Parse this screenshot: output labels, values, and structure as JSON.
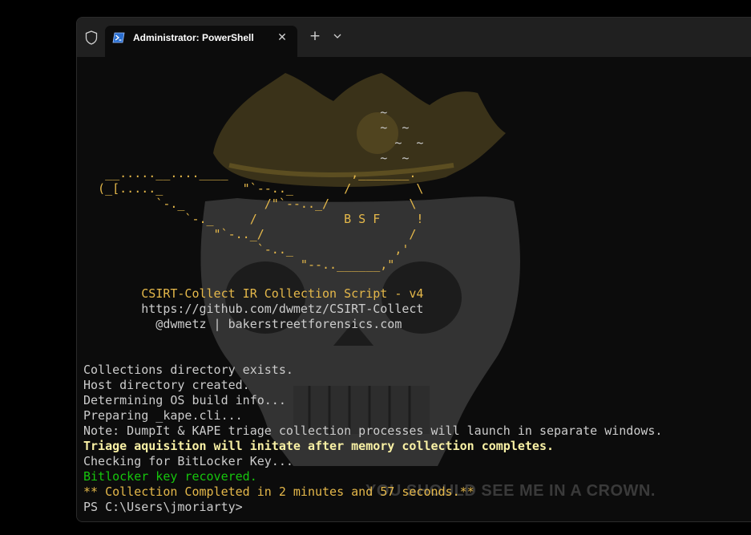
{
  "window": {
    "tab_title": "Administrator: PowerShell",
    "tab_close_glyph": "✕",
    "new_tab_glyph": "+",
    "icons": [
      "shield-icon",
      "powershell-icon",
      "close-icon",
      "plus-icon",
      "chevron-down-icon"
    ]
  },
  "background": {
    "caption": "YOU SHOULD SEE ME IN A CROWN."
  },
  "ascii_art": {
    "lines": [
      "                                         ~",
      "                                         ~  ~",
      "                                           ~  ~",
      "                                         ~  ~",
      "   __.....__....____                 ,_______.",
      "  (_[....._           \"`--.._       /         \\",
      "          `-._           /\"`--.._/           \\",
      "              `-._     /            B S F     !",
      "                  \"`-.._/                    /",
      "                        `-.._              ,'",
      "                              \"--..______,\""
    ]
  },
  "banner": {
    "title": "        CSIRT-Collect IR Collection Script - v4",
    "url": "        https://github.com/dwmetz/CSIRT-Collect",
    "credits": "          @dwmetz | bakerstreetforensics.com"
  },
  "log": [
    {
      "text": "Collections directory exists.",
      "style": "white"
    },
    {
      "text": "Host directory created.",
      "style": "white"
    },
    {
      "text": "Determining OS build info...",
      "style": "white"
    },
    {
      "text": "Preparing _kape.cli...",
      "style": "white"
    },
    {
      "text": "Note: DumpIt & KAPE triage collection processes will launch in separate windows.",
      "style": "white"
    },
    {
      "text": "Triage aquisition will initate after memory collection completes.",
      "style": "yellow"
    },
    {
      "text": "Checking for BitLocker Key...",
      "style": "white"
    },
    {
      "text": "Bitlocker key recovered.",
      "style": "green"
    },
    {
      "text": "** Collection Completed in 2 minutes and 57 seconds.**",
      "style": "orange"
    },
    {
      "text": "PS C:\\Users\\jmoriarty>",
      "style": "white"
    }
  ],
  "colors": {
    "terminal_bg": "#0c0c0c",
    "titlebar_bg": "#202020",
    "ascii_gold": "#e5b84a",
    "text_default": "#cccccc",
    "highlight_yellow": "#f9f1a5",
    "success_green": "#16c60c"
  }
}
